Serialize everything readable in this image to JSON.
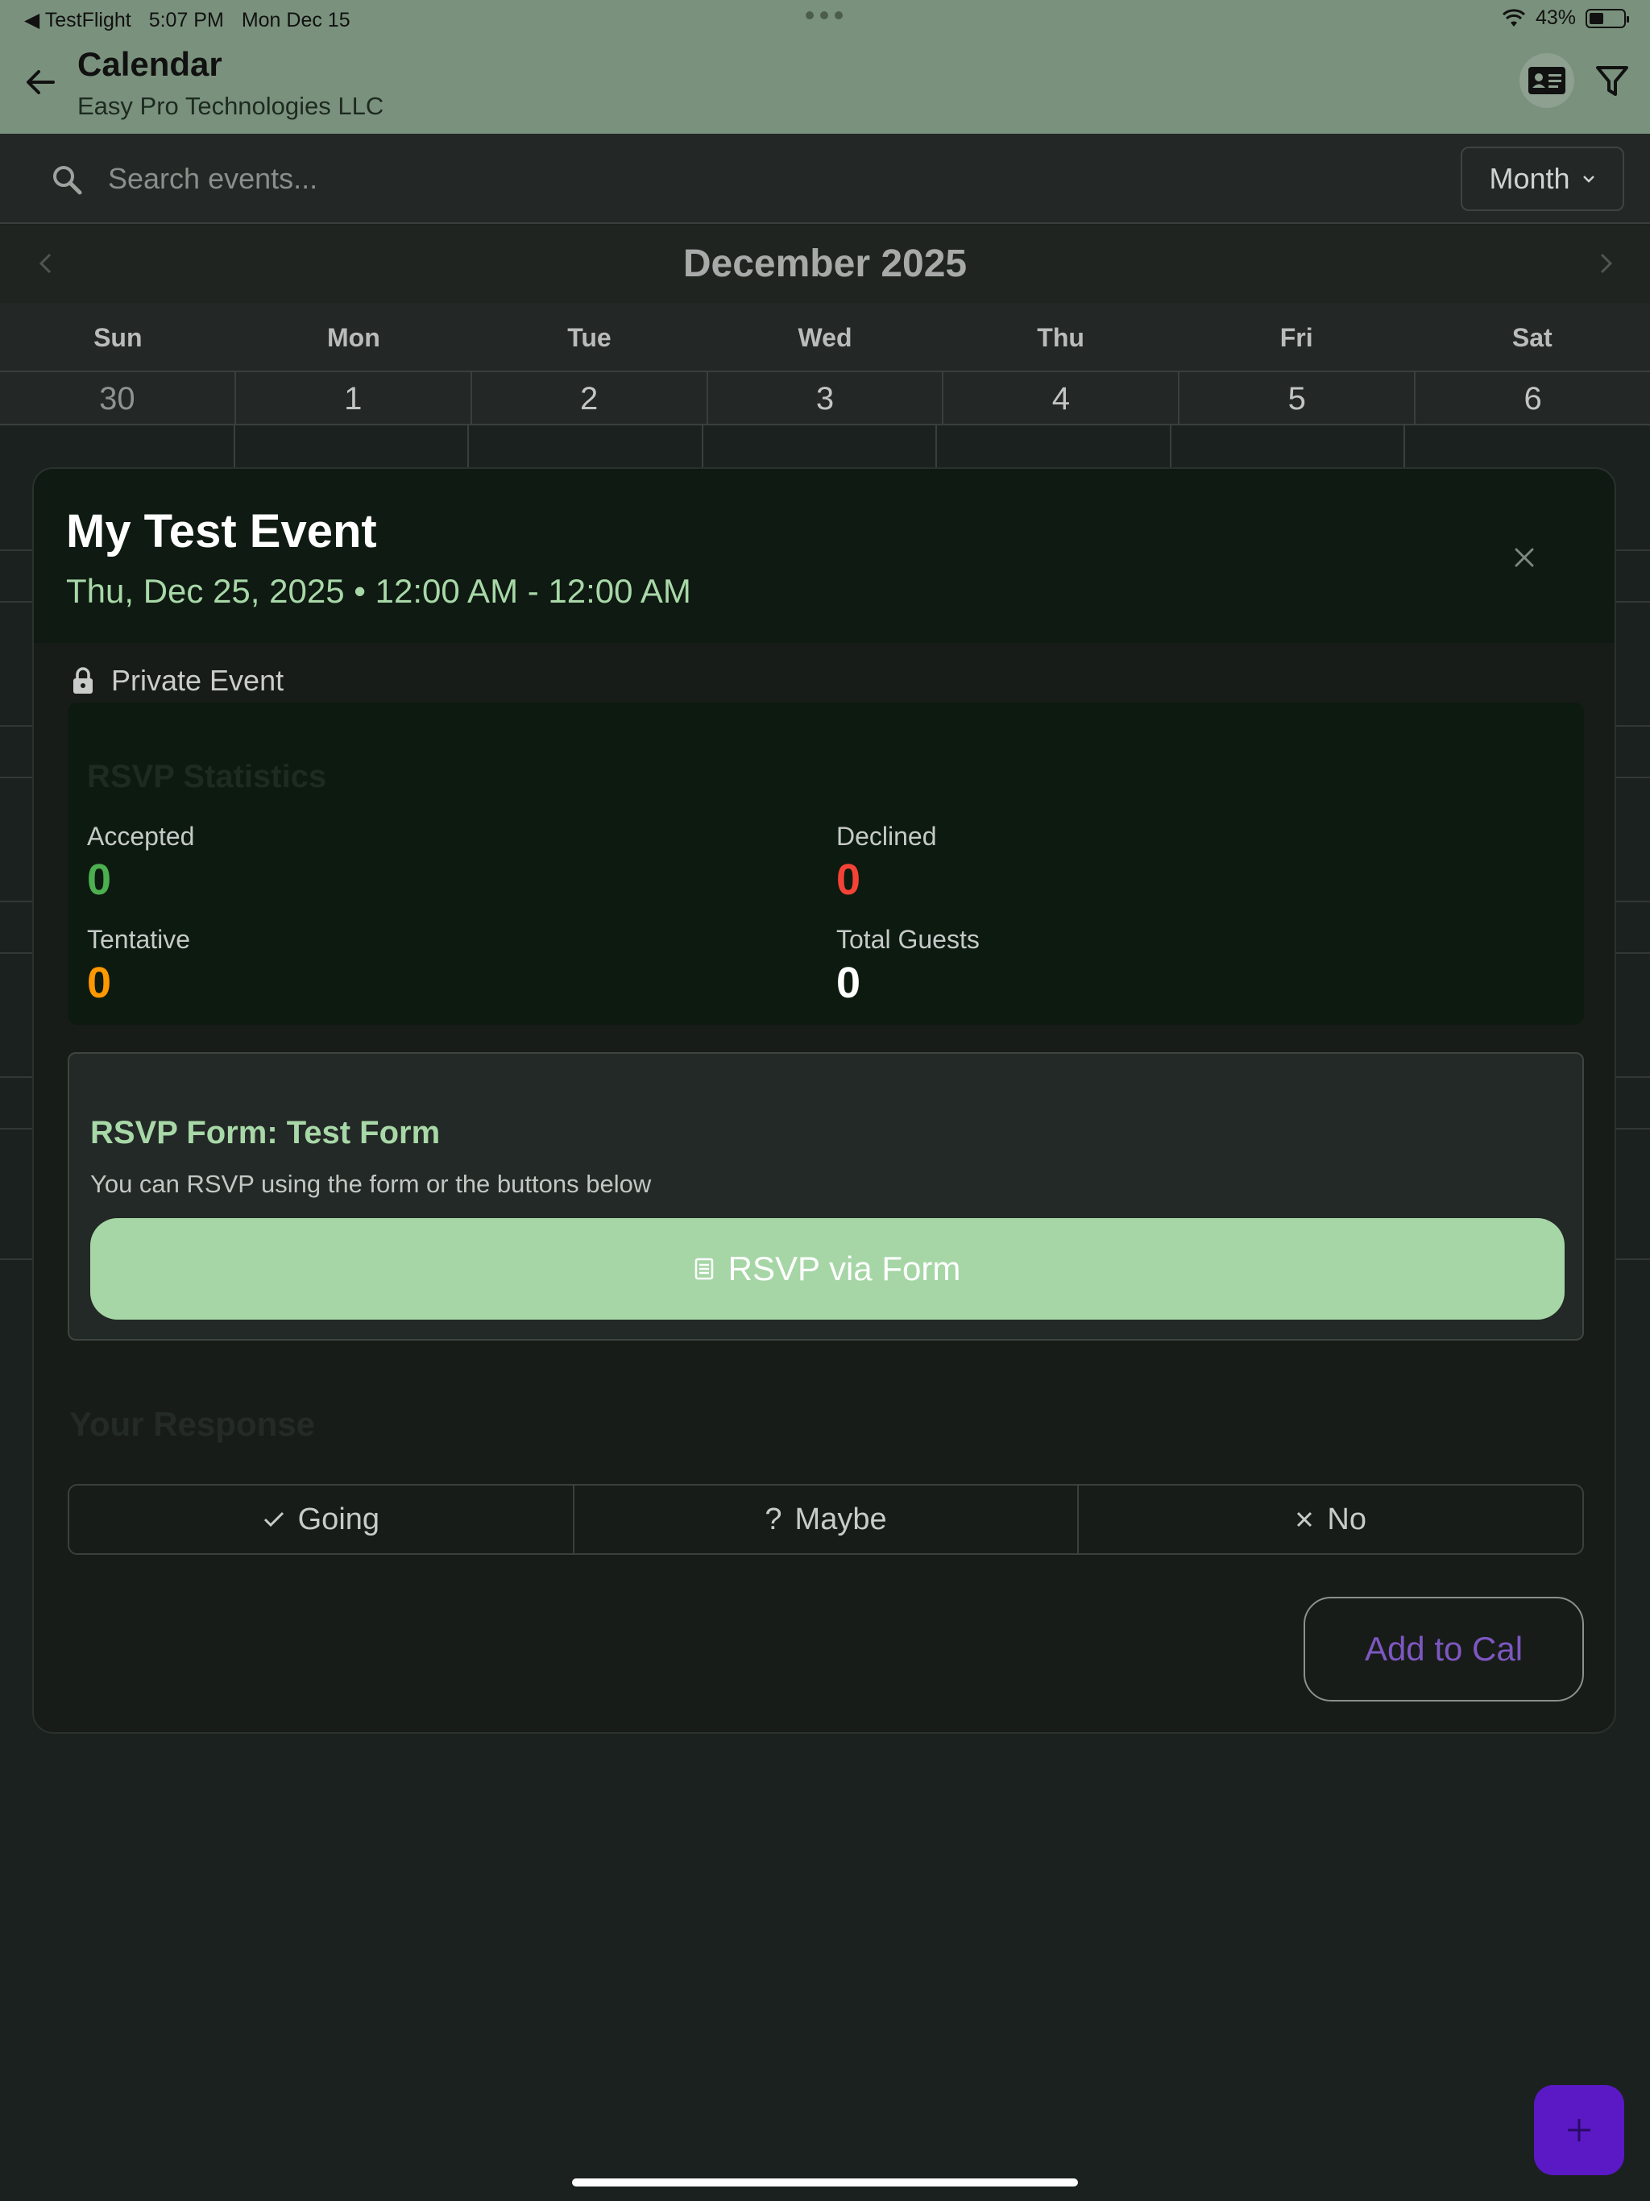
{
  "status_bar": {
    "back_app": "◀ TestFlight",
    "time": "5:07 PM",
    "date": "Mon Dec 15",
    "battery": "43%",
    "battery_level": 0.43
  },
  "app_bar": {
    "title": "Calendar",
    "subtitle": "Easy Pro Technologies LLC",
    "icons": [
      "arrow-left-icon",
      "contact-card-icon",
      "filter-icon"
    ]
  },
  "search": {
    "placeholder": "Search events...",
    "value": ""
  },
  "view_mode": {
    "selected": "Month"
  },
  "calendar": {
    "month_title": "December 2025",
    "weekdays": [
      "Sun",
      "Mon",
      "Tue",
      "Wed",
      "Thu",
      "Fri",
      "Sat"
    ],
    "first_week": [
      "30",
      "1",
      "2",
      "3",
      "4",
      "5",
      "6"
    ]
  },
  "event_modal": {
    "title": "My Test Event",
    "when": "Thu, Dec 25, 2025 • 12:00 AM - 12:00 AM",
    "privacy_label": "Private Event",
    "rsvp_stats": {
      "title": "RSVP Statistics",
      "accepted_label": "Accepted",
      "accepted_value": "0",
      "declined_label": "Declined",
      "declined_value": "0",
      "tentative_label": "Tentative",
      "tentative_value": "0",
      "total_label": "Total Guests",
      "total_value": "0"
    },
    "rsvp_form": {
      "title": "RSVP Form: Test Form",
      "description": "You can RSVP using the form or the buttons below",
      "button_label": "RSVP via Form"
    },
    "response": {
      "title": "Your Response",
      "going_label": "Going",
      "maybe_label": "Maybe",
      "no_label": "No"
    },
    "add_to_cal_label": "Add to Cal"
  },
  "colors": {
    "app_bar": "#7a927d",
    "accent_green": "#a8d8a8",
    "accepted": "#4caf50",
    "declined": "#f44336",
    "tentative": "#ff9800",
    "add_to_cal": "#7e57c2",
    "fab": "#5a19c4"
  }
}
